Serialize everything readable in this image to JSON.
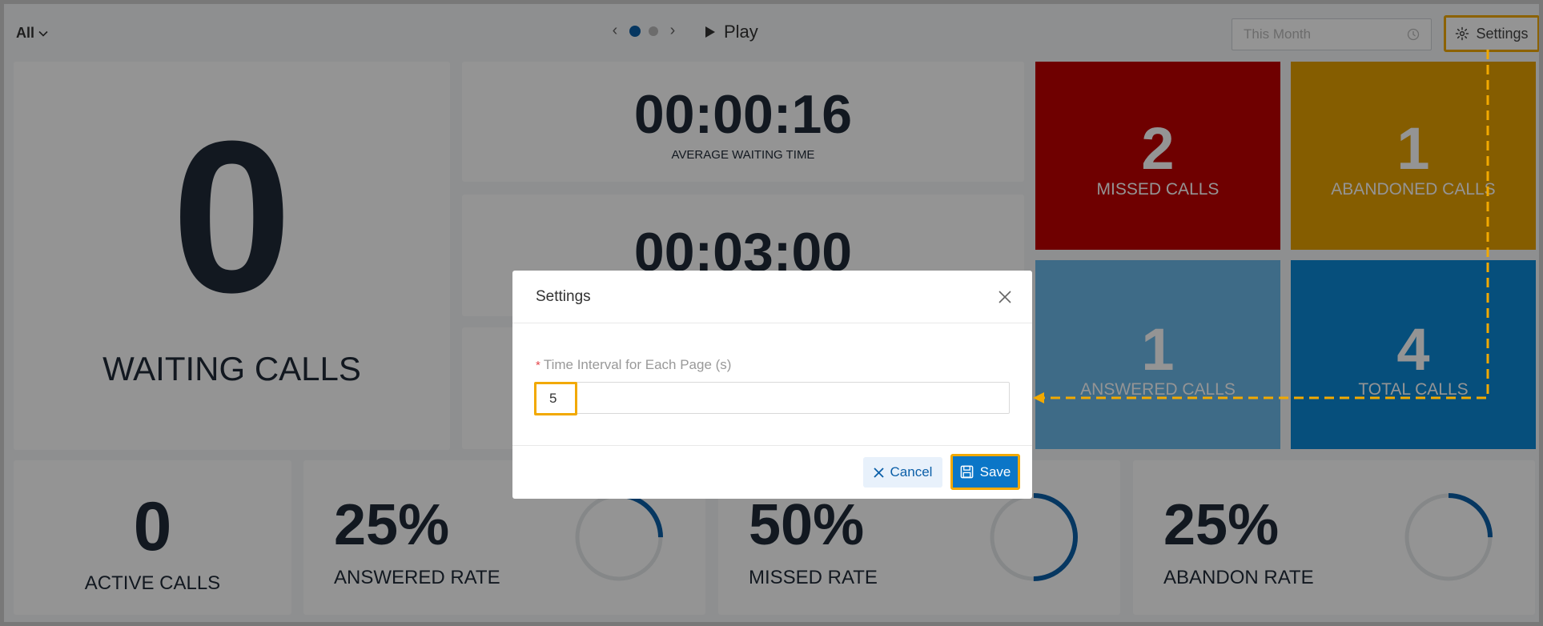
{
  "colors": {
    "missed_tile": "#c00000",
    "abandoned_tile": "#e6a000",
    "answered_tile": "#6cb8e8",
    "total_tile": "#0c88d6",
    "accent_blue": "#0b5fa8",
    "highlight": "#f2a900"
  },
  "topbar": {
    "filter_label": "All",
    "play_label": "Play",
    "date_range": "This Month",
    "settings_label": "Settings"
  },
  "waiting": {
    "value": "0",
    "label": "WAITING CALLS"
  },
  "times": [
    {
      "value": "00:00:16",
      "label": "AVERAGE WAITING TIME"
    },
    {
      "value": "00:03:00",
      "label": ""
    },
    {
      "value": "",
      "label": ""
    }
  ],
  "tiles": {
    "missed": {
      "value": "2",
      "label": "MISSED CALLS"
    },
    "abandoned": {
      "value": "1",
      "label": "ABANDONED CALLS"
    },
    "answered": {
      "value": "1",
      "label": "ANSWERED CALLS"
    },
    "total": {
      "value": "4",
      "label": "TOTAL CALLS"
    }
  },
  "active": {
    "value": "0",
    "label": "ACTIVE CALLS"
  },
  "rates": [
    {
      "value": "25%",
      "label": "ANSWERED RATE",
      "fraction": 0.25
    },
    {
      "value": "50%",
      "label": "MISSED RATE",
      "fraction": 0.5
    },
    {
      "value": "25%",
      "label": "ABANDON RATE",
      "fraction": 0.25
    }
  ],
  "modal": {
    "title": "Settings",
    "field_label": "Time Interval for Each Page (s)",
    "required_mark": "*",
    "field_value": "5",
    "cancel_label": "Cancel",
    "save_label": "Save"
  }
}
